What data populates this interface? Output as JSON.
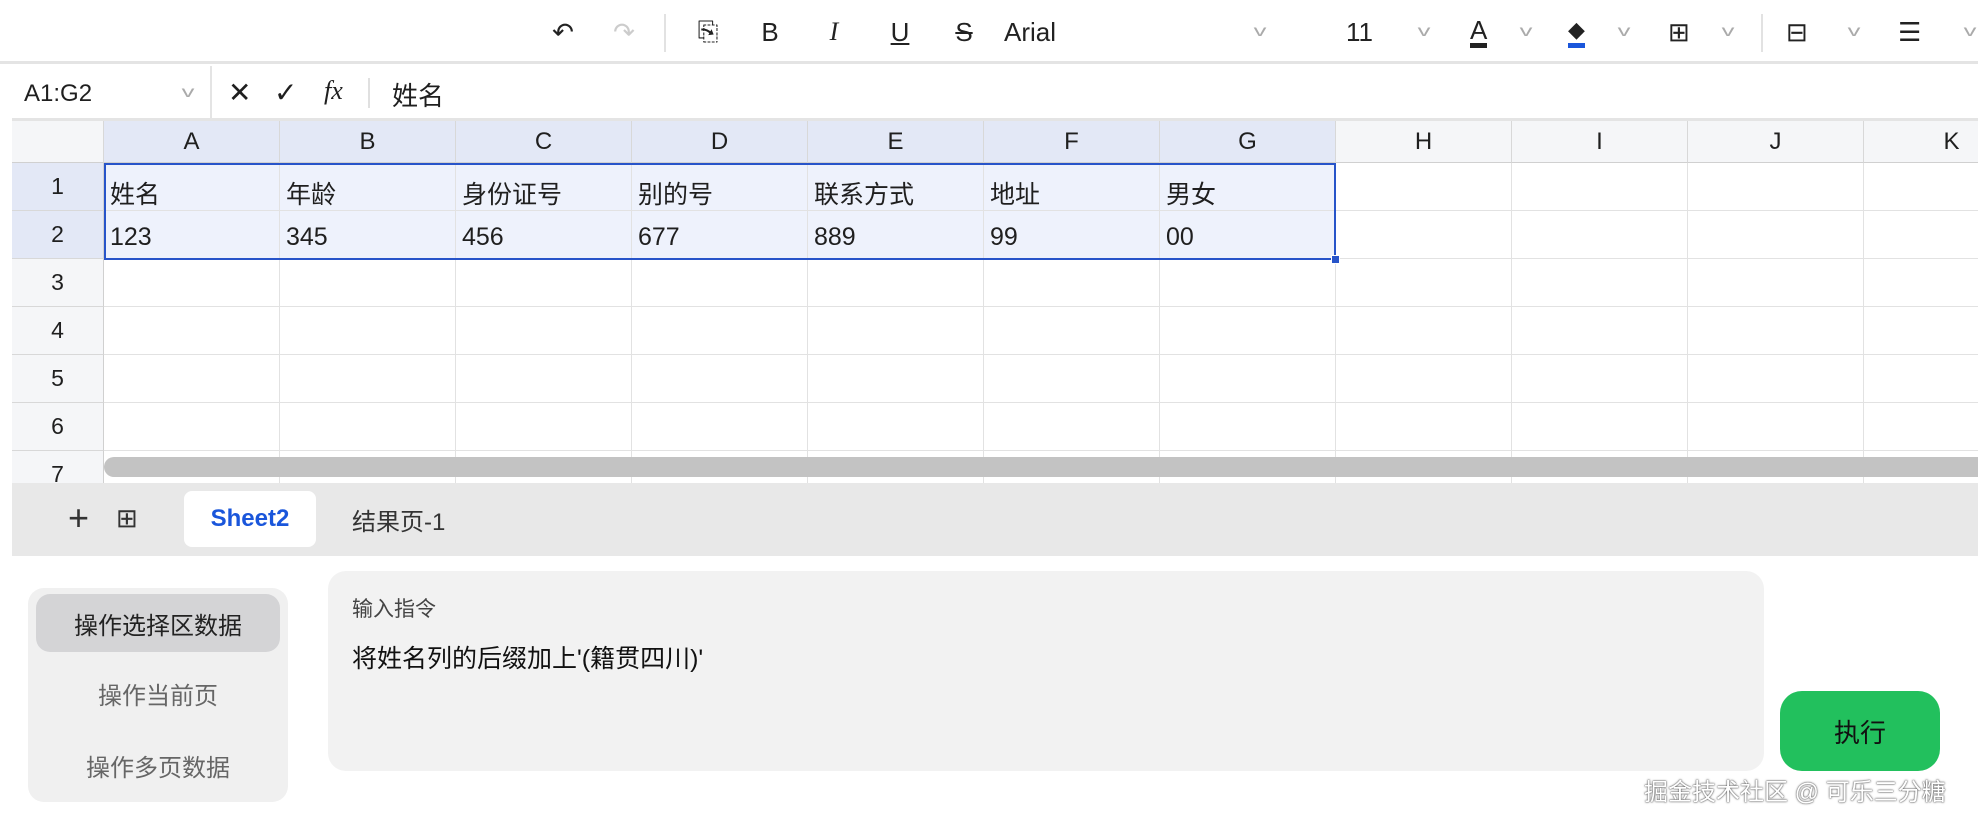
{
  "toolbar": {
    "font": "Arial",
    "font_size": "11",
    "colors": {
      "text": "#222222",
      "fill": "#1a56db"
    }
  },
  "formula_bar": {
    "name_box": "A1:G2",
    "content": "姓名",
    "fx": "fx"
  },
  "columns": [
    "A",
    "B",
    "C",
    "D",
    "E",
    "F",
    "G",
    "H",
    "I",
    "J",
    "K"
  ],
  "rows": [
    "1",
    "2",
    "3",
    "4",
    "5",
    "6",
    "7"
  ],
  "cells": [
    [
      "姓名",
      "年龄",
      "身份证号",
      "别的号",
      "联系方式",
      "地址",
      "男女"
    ],
    [
      "123",
      "345",
      "456",
      "677",
      "889",
      "99",
      "00"
    ]
  ],
  "sheets": {
    "tabs": [
      "Sheet2",
      "结果页-1"
    ],
    "active": "Sheet2"
  },
  "modes": [
    "操作选择区数据",
    "操作当前页",
    "操作多页数据"
  ],
  "command": {
    "label": "输入指令",
    "value": "将姓名列的后缀加上'(籍贯四川)'"
  },
  "run_label": "执行",
  "watermark": "掘金技术社区 @ 可乐三分糖",
  "accent": "#2754c9",
  "run_color": "#22c05d"
}
